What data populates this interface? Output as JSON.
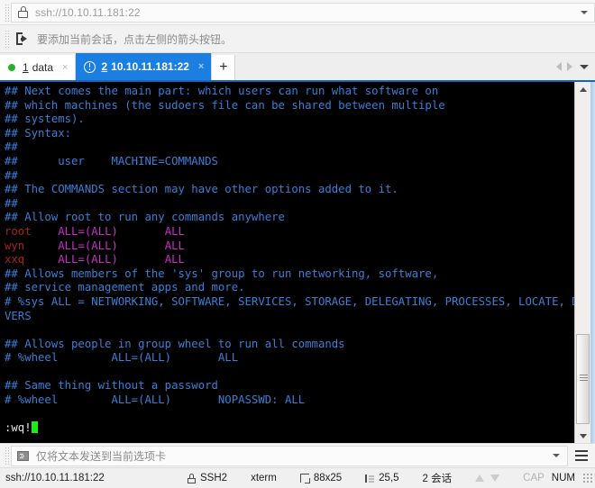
{
  "address_bar": {
    "icon": "lock-icon",
    "value": "ssh://10.10.11.181:22",
    "dropdown_icon": "chevron-down-icon"
  },
  "hint_bar": {
    "icon": "add-session-arrow-icon",
    "text": "要添加当前会话，点击左侧的箭头按钮。"
  },
  "tabs": {
    "items": [
      {
        "index": "1",
        "label": "data",
        "status_icon": "green-dot-icon",
        "active": false,
        "close_label": "×"
      },
      {
        "index": "2",
        "label": "10.10.11.181:22",
        "status_icon": "warning-circle-icon",
        "active": true,
        "close_label": "×"
      }
    ],
    "new_tab_label": "+",
    "nav_prev_icon": "chevron-left-icon",
    "nav_next_icon": "chevron-right-icon",
    "nav_menu_icon": "chevron-down-icon"
  },
  "terminal": {
    "lines": [
      [
        {
          "t": "## Next comes the main part: which users can run what software on",
          "c": "comment"
        }
      ],
      [
        {
          "t": "## which machines (the sudoers file can be shared between multiple",
          "c": "comment"
        }
      ],
      [
        {
          "t": "## systems).",
          "c": "comment"
        }
      ],
      [
        {
          "t": "## Syntax:",
          "c": "comment"
        }
      ],
      [
        {
          "t": "##",
          "c": "comment"
        }
      ],
      [
        {
          "t": "##      user    MACHINE=COMMANDS",
          "c": "comment"
        }
      ],
      [
        {
          "t": "##",
          "c": "comment"
        }
      ],
      [
        {
          "t": "## The COMMANDS section may have other options added to it.",
          "c": "comment"
        }
      ],
      [
        {
          "t": "##",
          "c": "comment"
        }
      ],
      [
        {
          "t": "## Allow root to run any commands anywhere",
          "c": "comment"
        }
      ],
      [
        {
          "t": "root",
          "c": "user"
        },
        {
          "t": "    ",
          "c": "plain"
        },
        {
          "t": "ALL=(ALL)",
          "c": "spec"
        },
        {
          "t": "       ",
          "c": "plain"
        },
        {
          "t": "ALL",
          "c": "spec"
        }
      ],
      [
        {
          "t": "wyn",
          "c": "user"
        },
        {
          "t": "     ",
          "c": "plain"
        },
        {
          "t": "ALL=(ALL)",
          "c": "spec"
        },
        {
          "t": "       ",
          "c": "plain"
        },
        {
          "t": "ALL",
          "c": "spec"
        }
      ],
      [
        {
          "t": "xxq",
          "c": "user"
        },
        {
          "t": "     ",
          "c": "plain"
        },
        {
          "t": "ALL=(ALL)",
          "c": "spec"
        },
        {
          "t": "       ",
          "c": "plain"
        },
        {
          "t": "ALL",
          "c": "spec"
        }
      ],
      [
        {
          "t": "## Allows members of the 'sys' group to run networking, software,",
          "c": "comment"
        }
      ],
      [
        {
          "t": "## service management apps and more.",
          "c": "comment"
        }
      ],
      [
        {
          "t": "# %sys ALL = NETWORKING, SOFTWARE, SERVICES, STORAGE, DELEGATING, PROCESSES, LOCATE, DRI",
          "c": "comment"
        }
      ],
      [
        {
          "t": "VERS",
          "c": "comment"
        }
      ],
      [
        {
          "t": "",
          "c": "plain"
        }
      ],
      [
        {
          "t": "## Allows people in group wheel to run all commands",
          "c": "comment"
        }
      ],
      [
        {
          "t": "# %wheel        ALL=(ALL)       ALL",
          "c": "comment"
        }
      ],
      [
        {
          "t": "",
          "c": "plain"
        }
      ],
      [
        {
          "t": "## Same thing without a password",
          "c": "comment"
        }
      ],
      [
        {
          "t": "# %wheel        ALL=(ALL)       NOPASSWD: ALL",
          "c": "comment"
        }
      ],
      [
        {
          "t": "",
          "c": "plain"
        }
      ],
      [
        {
          "t": ":wq!",
          "c": "white"
        },
        {
          "t": "CURSOR",
          "c": "cursor"
        }
      ]
    ],
    "scrollbar": {
      "up_icon": "scroll-up-arrow-icon",
      "down_icon": "scroll-down-arrow-icon"
    }
  },
  "send_bar": {
    "icon": "terminal-icon",
    "placeholder": "仅将文本发送到当前选项卡",
    "value": "",
    "dropdown_icon": "chevron-down-icon",
    "menu_icon": "hamburger-menu-icon"
  },
  "status_bar": {
    "url": "ssh://10.10.11.181:22",
    "protocol": "SSH2",
    "protocol_icon": "lock-icon",
    "terminal_type": "xterm",
    "size": "88x25",
    "size_icon": "resize-icon",
    "cursor_position": "25,5",
    "cursor_icon": "cursor-position-icon",
    "sessions": "2 会话",
    "upload_icon": "upload-arrow-icon",
    "download_icon": "download-arrow-icon",
    "caps_lock": "CAP",
    "num_lock": "NUM",
    "resize_grip_icon": "resize-grip-icon"
  },
  "colors": {
    "accent": "#1a7fe0",
    "tab_active_bg": "#1a7fe0",
    "terminal_bg": "#000000",
    "comment": "#3a7fd5",
    "user": "#a82020",
    "spec": "#c72ec7",
    "cursor": "#18ef18",
    "status_ok": "#22b522"
  }
}
